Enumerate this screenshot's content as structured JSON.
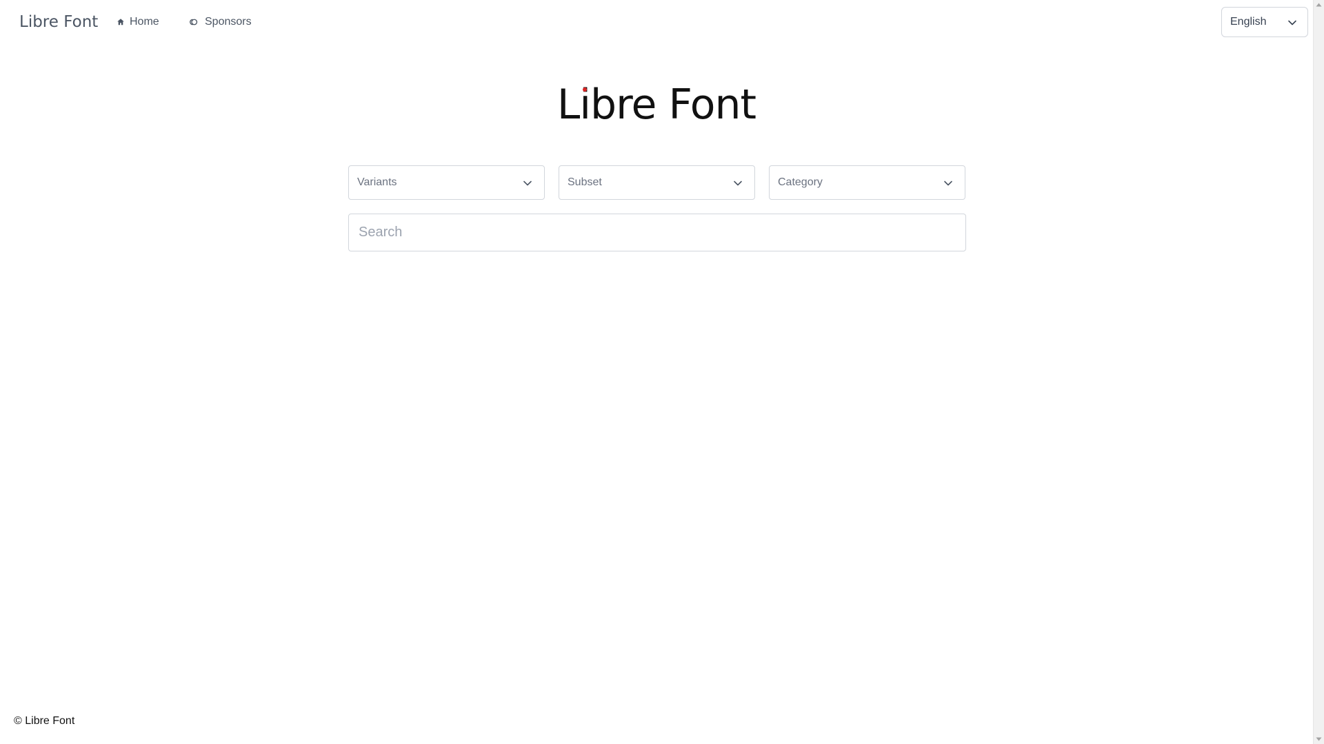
{
  "nav": {
    "brand": "Libre Font",
    "links": [
      {
        "label": "Home",
        "icon": "home-icon"
      },
      {
        "label": "Sponsors",
        "icon": "sponsors-icon"
      }
    ],
    "language": {
      "selected": "English"
    }
  },
  "hero": {
    "title_before": "L",
    "title_i": "i",
    "title_after": "bre Font",
    "accent_color": "#dc2626"
  },
  "filters": {
    "variants": "Variants",
    "subset": "Subset",
    "category": "Category"
  },
  "search": {
    "placeholder": "Search",
    "value": ""
  },
  "footer": {
    "text": "© Libre Font"
  }
}
